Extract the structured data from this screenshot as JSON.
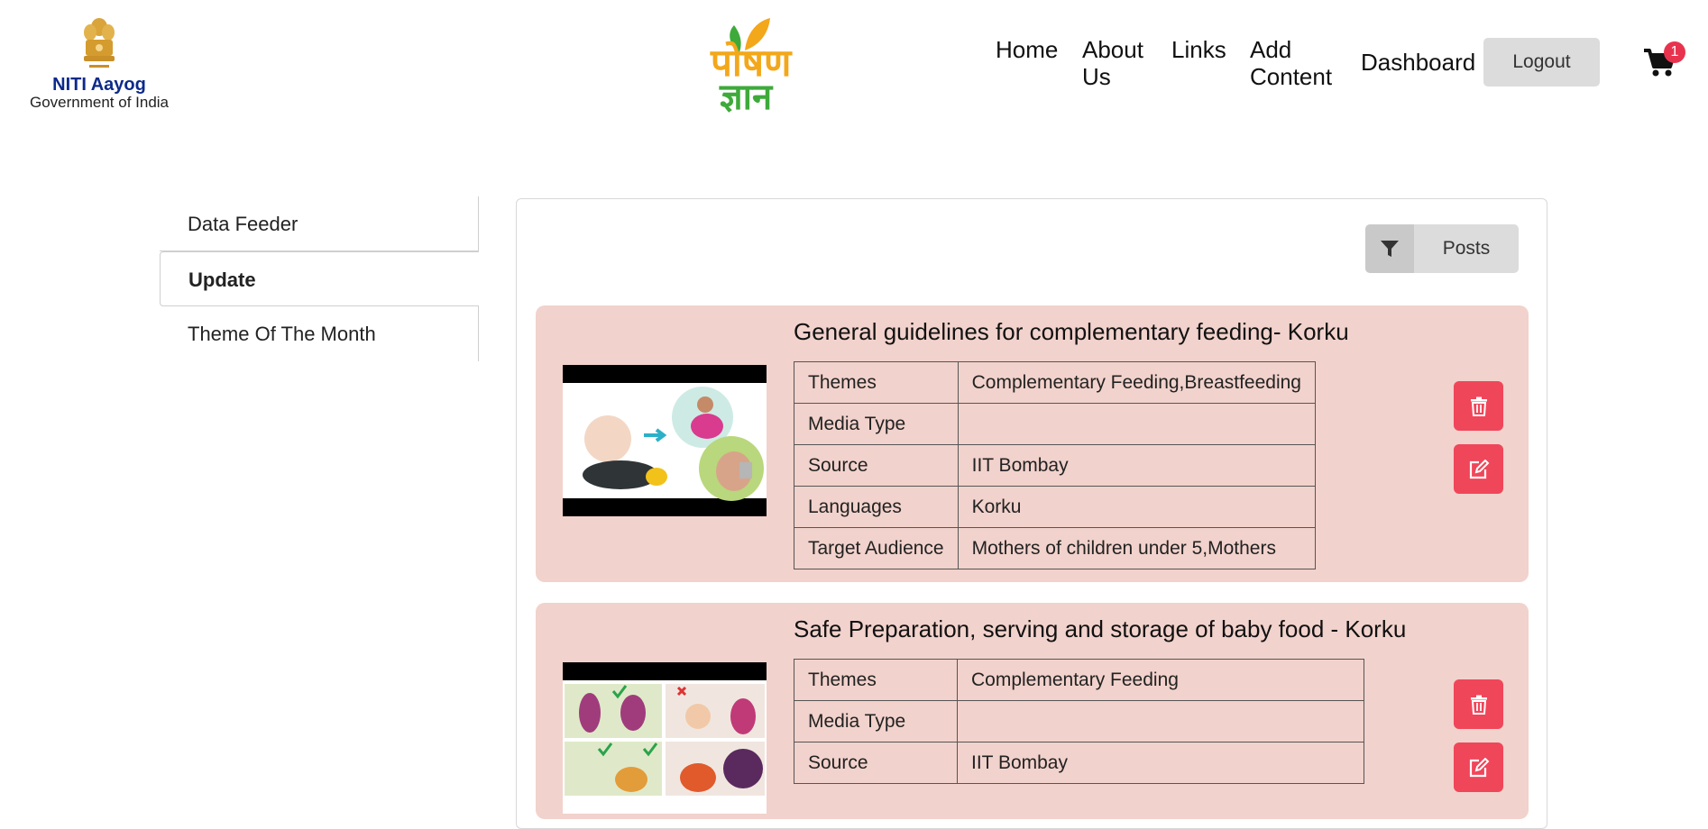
{
  "header": {
    "gov_logo": {
      "name": "NITI Aayog",
      "subtitle": "Government of India"
    },
    "brand_logo": {
      "line1": "पोषण",
      "line2": "ज्ञान"
    },
    "nav": [
      {
        "label": "Home"
      },
      {
        "label": "About Us"
      },
      {
        "label": "Links"
      },
      {
        "label": "Add Content"
      },
      {
        "label": "Dashboard"
      }
    ],
    "logout_label": "Logout",
    "cart_count": "1",
    "icons": {
      "cart": "shopping-cart-icon",
      "emblem": "national-emblem-icon"
    }
  },
  "sidebar": {
    "items": [
      {
        "label": "Data Feeder",
        "active": false
      },
      {
        "label": "Update",
        "active": true
      },
      {
        "label": "Theme Of The Month",
        "active": false
      }
    ]
  },
  "main": {
    "filter": {
      "label": "Posts",
      "icon": "filter-icon"
    },
    "posts": [
      {
        "title": "General guidelines for complementary feeding- Korku",
        "fields": [
          {
            "key": "Themes",
            "value": "Complementary Feeding,Breastfeeding"
          },
          {
            "key": "Media Type",
            "value": ""
          },
          {
            "key": "Source",
            "value": "IIT Bombay"
          },
          {
            "key": "Languages",
            "value": "Korku"
          },
          {
            "key": "Target Audience",
            "value": "Mothers of children under 5,Mothers"
          }
        ]
      },
      {
        "title": "Safe Preparation, serving and storage of baby food - Korku",
        "fields": [
          {
            "key": "Themes",
            "value": "Complementary Feeding"
          },
          {
            "key": "Media Type",
            "value": ""
          },
          {
            "key": "Source",
            "value": "IIT Bombay"
          }
        ]
      }
    ],
    "actions": {
      "delete_icon": "trash-icon",
      "edit_icon": "edit-icon"
    }
  },
  "colors": {
    "card_bg": "#f2d2cc",
    "action_button": "#f0465a",
    "badge": "#e8334f",
    "logout_bg": "#dcdcdc",
    "gov_text": "#0d2a8a",
    "brand_orange": "#f3a71a",
    "brand_green": "#3eaa3a"
  }
}
